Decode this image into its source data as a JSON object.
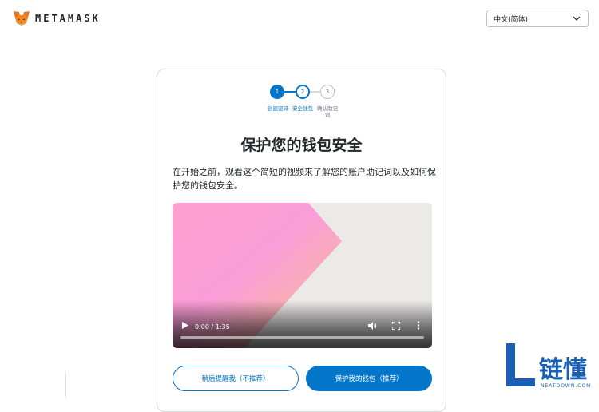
{
  "header": {
    "brand": "METAMASK",
    "language_selected": "中文(简体)"
  },
  "steps": [
    {
      "number": "1",
      "label": "创建密码",
      "state": "complete"
    },
    {
      "number": "2",
      "label": "安全钱包",
      "state": "active"
    },
    {
      "number": "3",
      "label": "确认助记词",
      "state": "pending"
    }
  ],
  "main": {
    "title": "保护您的钱包安全",
    "description": "在开始之前，观看这个简短的视频来了解您的账户助记词以及如何保护您的钱包安全。"
  },
  "video": {
    "time": "0:00 / 1:35",
    "progress": 0
  },
  "buttons": {
    "remind_later": "稍后提醒我（不推荐）",
    "secure_wallet": "保护我的钱包（推荐）"
  },
  "watermark": {
    "text": "链懂",
    "sub": "NEATDOWN.COM"
  },
  "colors": {
    "primary": "#0376c9",
    "text": "#24272a",
    "border": "#d6d9dc"
  }
}
